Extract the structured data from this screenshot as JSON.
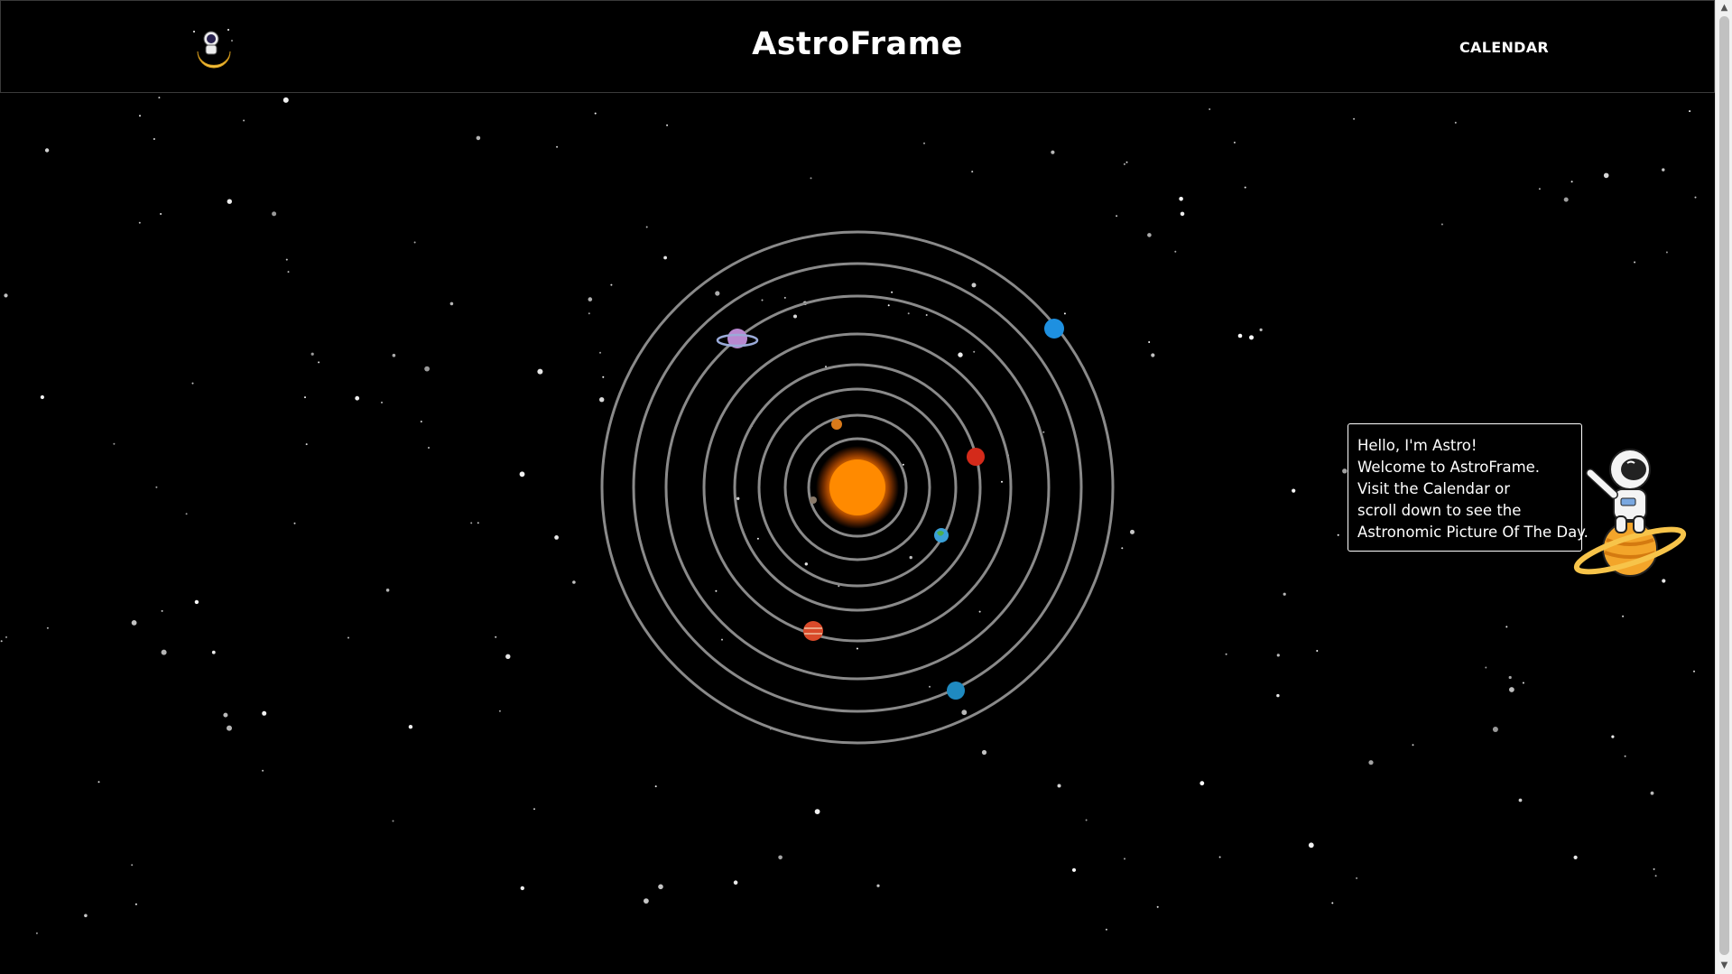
{
  "header": {
    "title": "AstroFrame",
    "nav_calendar": "CALENDAR"
  },
  "mascot": {
    "lines": [
      "Hello, I'm Astro!",
      "Welcome to AstroFrame.",
      "Visit the Calendar or",
      "scroll down to see the",
      "Astronomic Picture Of The Day."
    ]
  },
  "colors": {
    "background": "#000000",
    "orbit": "#8a8a8a",
    "sun": "#ff8a00",
    "text": "#ffffff"
  },
  "icons": {
    "logo": "astronaut-on-moon-icon",
    "mascot": "astronaut-on-planet-icon"
  }
}
